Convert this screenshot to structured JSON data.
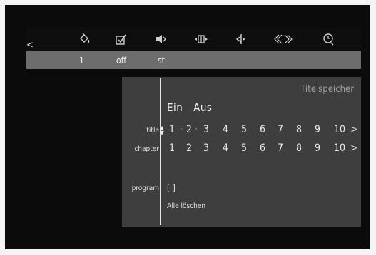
{
  "toolbar": {
    "icons": [
      "paint-bucket-icon",
      "checkbox-icon",
      "speaker-icon",
      "ab-repeat-icon",
      "angle-icon",
      "zoom-icon",
      "clock-icon"
    ],
    "values": [
      "1",
      "off",
      "st"
    ]
  },
  "panel": {
    "title": "Titelspeicher",
    "toggle_on": "Ein",
    "toggle_off": "Aus",
    "title_label": "title",
    "chapter_label": "chapter",
    "program_label": "program",
    "numbers": [
      "1",
      "2",
      "3",
      "4",
      "5",
      "6",
      "7",
      "8",
      "9",
      "10"
    ],
    "more": ">",
    "program_value": "[ ]",
    "clear_all": "Alle löschen"
  }
}
